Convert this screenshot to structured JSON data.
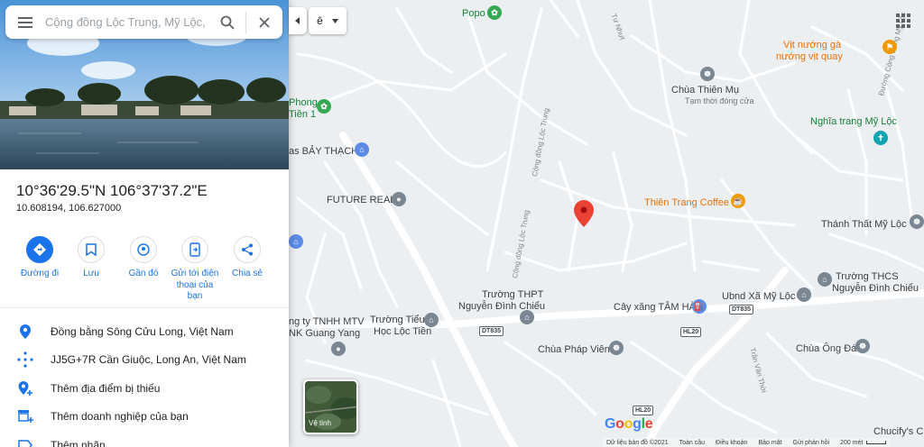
{
  "search": {
    "placeholder": "Cộng đồng Lộc Trung, Mỹ Lộc, Cần Giuộc"
  },
  "place": {
    "title": "10°36'29.5\"N 106°37'37.2\"E",
    "decimal": "10.608194, 106.627000"
  },
  "actions": [
    {
      "label": "Đường đi",
      "icon": "directions-icon"
    },
    {
      "label": "Lưu",
      "icon": "bookmark-icon"
    },
    {
      "label": "Gần đó",
      "icon": "nearby-icon"
    },
    {
      "label": "Gửi tới điện thoại của bạn",
      "icon": "send-to-phone-icon"
    },
    {
      "label": "Chia sẻ",
      "icon": "share-icon"
    }
  ],
  "info": [
    {
      "text": "Đồng bằng Sông Cửu Long, Việt Nam",
      "icon": "location-pin-icon"
    },
    {
      "text": "JJ5G+7R Cần Giuộc, Long An, Việt Nam",
      "icon": "plus-code-icon"
    },
    {
      "text": "Thêm địa điểm bị thiếu",
      "icon": "add-place-icon"
    },
    {
      "text": "Thêm doanh nghiệp của bạn",
      "icon": "add-business-icon"
    },
    {
      "text": "Thêm nhãn",
      "icon": "label-icon"
    }
  ],
  "transit_toggle": {
    "label": "ê"
  },
  "satellite": {
    "label": "Vệ tinh"
  },
  "footer": {
    "data": "Dữ liệu bản đồ ©2021",
    "global": "Toàn cầu",
    "terms": "Điều khoản",
    "privacy": "Bảo mật",
    "feedback": "Gửi phản hồi",
    "scale": "200 mét"
  },
  "map_labels": {
    "popo": "Popo",
    "vit_nuong": "Vịt nướng gà",
    "vit_nuong2": "nướng vịt quay",
    "chua_thien_mu": "Chùa Thiên Mụ",
    "tam_thoi": "Tạm thời đóng cửa",
    "nghia_trang": "Nghĩa trang Mỹ Lộc",
    "phong": "Phong",
    "tien1": "Tiền 1",
    "bay_thach": "as BẢY THẠCH",
    "future_real": "FUTURE REAL",
    "thien_trang": "Thiên Trang Coffee",
    "thanh_that": "Thánh Thất Mỹ Lộc",
    "truong_thcs": "Trường THCS",
    "nguyen_dinh_chieu2": "Nguyễn Đình Chiểu",
    "ubnd": "Ubnd Xã Mỹ Lộc",
    "cay_xang": "Cây xăng TÂM HÀ",
    "truong_thpt": "Trường THPT",
    "nguyen_dinh_chieu": "Nguyễn Đình Chiểu",
    "cong_ty": "ng ty TNHH MTV",
    "guang_yang": "NK Guang Yang",
    "truong_tieu": "Trường Tiểu",
    "hoc_loc_tien": "Học Lộc Tiền",
    "chua_phap_vien": "Chùa Pháp Viên",
    "chua_ong_da": "Chùa Ông Đá",
    "chucfy": "Chucify's C",
    "tu_nhut": "Tư Nhựt",
    "cong_dong_loc_trung": "Cộng đồng Lộc Trung",
    "cong_dong_loc_trung2": "Cộng đồng Lộc Trung",
    "duong_cong_dong": "Đường Cộng Đồng Mỹ Lộc",
    "tran_van_thoi": "Trần Văn Thời"
  },
  "shields": {
    "dt835a": "DT835",
    "dt835b": "DT835",
    "hl20a": "HL20",
    "hl20b": "HL20"
  },
  "brand": {
    "google": "Google"
  },
  "colors": {
    "accent": "#1a73e8",
    "pin": "#ea4335",
    "map_bg": "#eceff1"
  }
}
